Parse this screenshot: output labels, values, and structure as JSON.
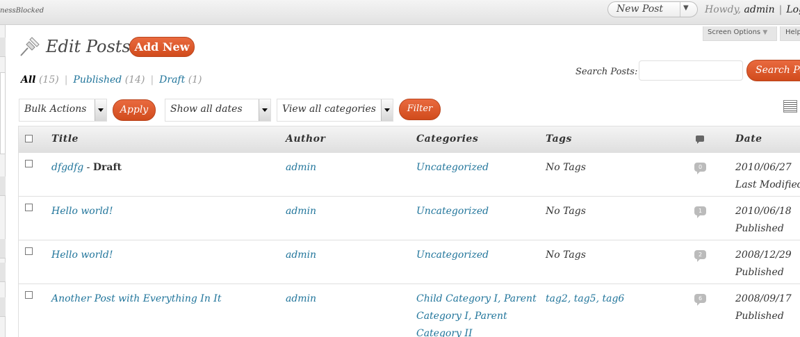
{
  "header": {
    "site_name": "nessBlocked",
    "new_post_label": "New Post",
    "howdy": "Howdy,",
    "user": "admin",
    "logout": "Log"
  },
  "tabs": {
    "screen_options": "Screen Options",
    "help": "Help"
  },
  "page": {
    "title": "Edit Posts",
    "add_new": "Add New"
  },
  "filters": [
    {
      "label": "All",
      "count": "(15)"
    },
    {
      "label": "Published",
      "count": "(14)"
    },
    {
      "label": "Draft",
      "count": "(1)"
    }
  ],
  "search": {
    "label": "Search Posts:",
    "value": "",
    "button": "Search Po"
  },
  "tablenav": {
    "bulk_actions": "Bulk Actions",
    "apply": "Apply",
    "dates": "Show all dates",
    "categories": "View all categories",
    "filter": "Filter"
  },
  "table": {
    "columns": [
      "Title",
      "Author",
      "Categories",
      "Tags",
      "Date"
    ],
    "rows": [
      {
        "title": "dfgdfg",
        "title_suffix": " - ",
        "state": "Draft",
        "author": "admin",
        "categories": [
          "Uncategorized"
        ],
        "tags": "No Tags",
        "comments": "0",
        "date": "2010/06/27",
        "status": "Last Modified"
      },
      {
        "title": "Hello world!",
        "title_suffix": "",
        "state": "",
        "author": "admin",
        "categories": [
          "Uncategorized"
        ],
        "tags": "No Tags",
        "comments": "1",
        "date": "2010/06/18",
        "status": "Published"
      },
      {
        "title": "Hello world!",
        "title_suffix": "",
        "state": "",
        "author": "admin",
        "categories": [
          "Uncategorized"
        ],
        "tags": "No Tags",
        "comments": "2",
        "date": "2008/12/29",
        "status": "Published"
      },
      {
        "title": "Another Post with Everything In It",
        "title_suffix": "",
        "state": "",
        "author": "admin",
        "categories": [
          "Child Category I, Parent",
          "Category I, Parent",
          "Category II"
        ],
        "tags": "tag2, tag5, tag6",
        "comments": "6",
        "date": "2008/09/17",
        "status": "Published"
      }
    ]
  }
}
